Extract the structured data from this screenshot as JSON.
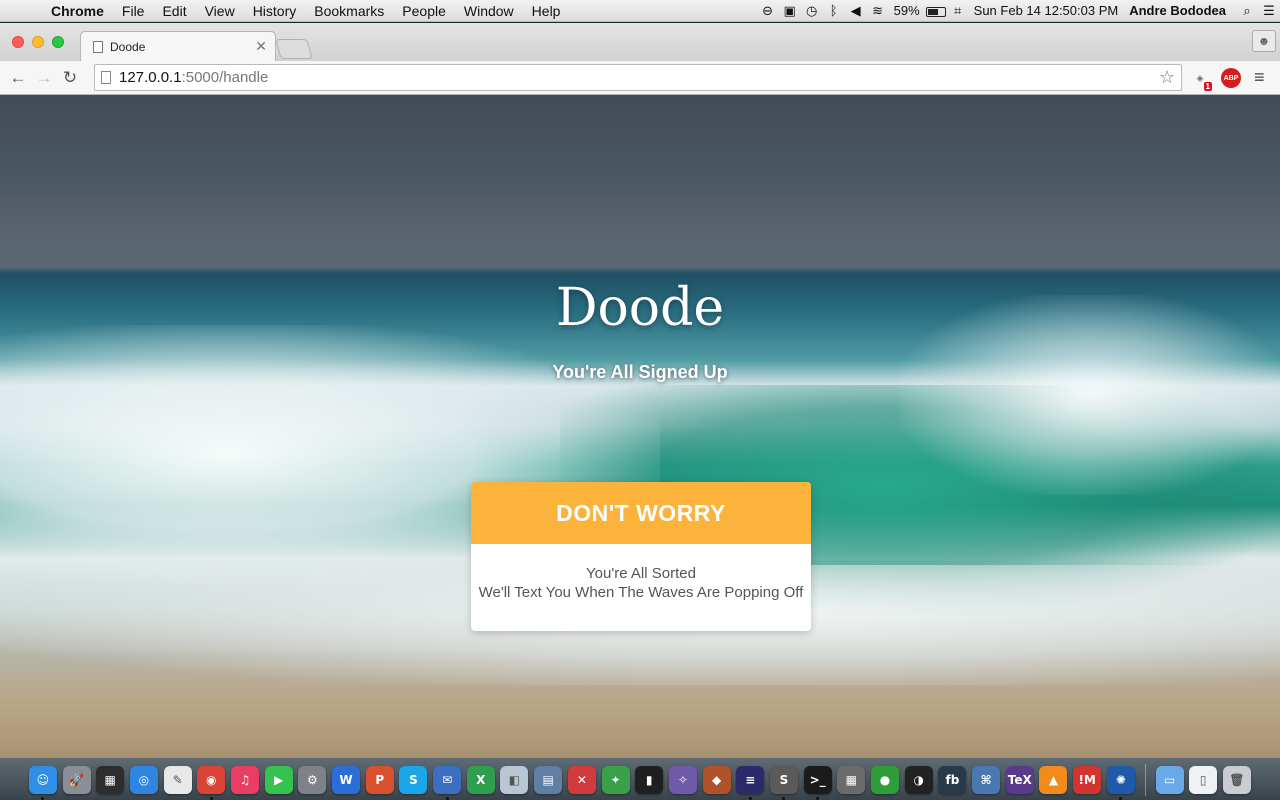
{
  "menubar": {
    "apple_glyph": "",
    "items": [
      "Chrome",
      "File",
      "Edit",
      "View",
      "History",
      "Bookmarks",
      "People",
      "Window",
      "Help"
    ],
    "battery_percent": "59%",
    "datetime": "Sun Feb 14  12:50:03 PM",
    "user": "Andre Bododea"
  },
  "browser": {
    "tab_title": "Doode",
    "url_host": "127.0.0.1",
    "url_rest": ":5000/handle",
    "ghostery_badge": "1",
    "abp_label": "ABP"
  },
  "page": {
    "title": "Doode",
    "subtitle": "You're All Signed Up",
    "card": {
      "header": "DON'T WORRY",
      "line1": "You're All Sorted",
      "line2": "We'll Text You When The Waves Are Popping Off"
    },
    "accent_color": "#fbb33b"
  },
  "dock": {
    "apps": [
      {
        "name": "finder",
        "color": "#2f8fe6",
        "glyph": "☺",
        "running": true
      },
      {
        "name": "launchpad",
        "color": "#8a8f96",
        "glyph": "🚀",
        "running": false
      },
      {
        "name": "mission-control",
        "color": "#2d2d2d",
        "glyph": "▦",
        "running": false
      },
      {
        "name": "safari",
        "color": "#2f86e0",
        "glyph": "◎",
        "running": false
      },
      {
        "name": "textedit",
        "color": "#e8e8e8",
        "glyph": "✎",
        "running": false
      },
      {
        "name": "chrome",
        "color": "#d94436",
        "glyph": "◉",
        "running": true
      },
      {
        "name": "itunes",
        "color": "#ea3d63",
        "glyph": "♫",
        "running": false
      },
      {
        "name": "facetime",
        "color": "#36c24e",
        "glyph": "▶",
        "running": false
      },
      {
        "name": "system-preferences",
        "color": "#7d8288",
        "glyph": "⚙",
        "running": false
      },
      {
        "name": "word",
        "color": "#2b6fd6",
        "glyph": "W",
        "running": false
      },
      {
        "name": "powerpoint",
        "color": "#d9502e",
        "glyph": "P",
        "running": false
      },
      {
        "name": "skype",
        "color": "#1ba6ea",
        "glyph": "S",
        "running": false
      },
      {
        "name": "thunderbird",
        "color": "#3c6fc0",
        "glyph": "✉",
        "running": true
      },
      {
        "name": "excel",
        "color": "#2f9e4f",
        "glyph": "X",
        "running": false
      },
      {
        "name": "preview",
        "color": "#b9c6d4",
        "glyph": "◧",
        "running": false
      },
      {
        "name": "image-capture",
        "color": "#5f7fa4",
        "glyph": "▤",
        "running": false
      },
      {
        "name": "crossover",
        "color": "#d23b3b",
        "glyph": "✕",
        "running": false
      },
      {
        "name": "sketchbook",
        "color": "#3aa04a",
        "glyph": "✦",
        "running": false
      },
      {
        "name": "activity-monitor",
        "color": "#1f1f1f",
        "glyph": "▮",
        "running": false
      },
      {
        "name": "xcode-tools",
        "color": "#6f5aa8",
        "glyph": "✧",
        "running": false
      },
      {
        "name": "cyberduck",
        "color": "#b0522a",
        "glyph": "◆",
        "running": false
      },
      {
        "name": "eclipse",
        "color": "#2d2a6b",
        "glyph": "≡",
        "running": true
      },
      {
        "name": "sublime-text",
        "color": "#5a5a5a",
        "glyph": "S",
        "running": true
      },
      {
        "name": "terminal",
        "color": "#1b1b1b",
        "glyph": ">_",
        "running": true
      },
      {
        "name": "calculator",
        "color": "#6b6b6b",
        "glyph": "▦",
        "running": false
      },
      {
        "name": "evernote",
        "color": "#2f9e3a",
        "glyph": "●",
        "running": false
      },
      {
        "name": "live",
        "color": "#222222",
        "glyph": "◑",
        "running": false
      },
      {
        "name": "flashbuilder",
        "color": "#2a3a4a",
        "glyph": "fb",
        "running": false
      },
      {
        "name": "python",
        "color": "#4a78b0",
        "glyph": "⌘",
        "running": false
      },
      {
        "name": "texshop",
        "color": "#5a3a8a",
        "glyph": "TeX",
        "running": false
      },
      {
        "name": "vlc",
        "color": "#f28a1e",
        "glyph": "▲",
        "running": false
      },
      {
        "name": "imo",
        "color": "#d2342f",
        "glyph": "!M",
        "running": false
      },
      {
        "name": "sourcetree",
        "color": "#1e5aa8",
        "glyph": "✺",
        "running": true
      }
    ],
    "trailing": [
      {
        "name": "applications-folder",
        "color": "#6aa9e8",
        "glyph": "▭",
        "running": false
      },
      {
        "name": "documents-stack",
        "color": "#eef2f6",
        "glyph": "▯",
        "running": false
      },
      {
        "name": "trash",
        "color": "#c9cdd2",
        "glyph": "🗑",
        "running": false
      }
    ]
  }
}
